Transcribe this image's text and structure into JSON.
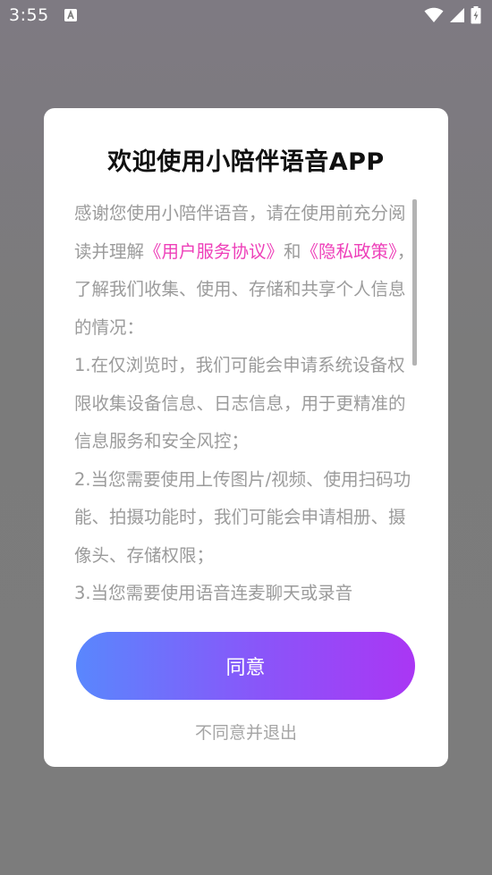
{
  "status_bar": {
    "time": "3:55",
    "icons": [
      "a-icon",
      "wifi-icon",
      "signal-icon",
      "battery-icon"
    ]
  },
  "dialog": {
    "title": "欢迎使用小陪伴语音APP",
    "intro_prefix": "感谢您使用小陪伴语音，请在使用前充分阅读并理解",
    "link_user_agreement": "《用户服务协议》",
    "intro_and": "和",
    "link_privacy_policy": "《隐私政策》",
    "intro_suffix": "，了解我们收集、使用、存储和共享个人信息的情况：",
    "item_1": " 1.在仅浏览时，我们可能会申请系统设备权限收集设备信息、日志信息，用于更精准的信息服务和安全风控；",
    "item_2": " 2.当您需要使用上传图片/视频、使用扫码功能、拍摄功能时，我们可能会申请相册、摄像头、存储权限；",
    "item_3": " 3.当您需要使用语音连麦聊天或录音",
    "agree_label": "同意",
    "disagree_label": "不同意并退出"
  },
  "colors": {
    "link": "#ee3fb9",
    "button_gradient_start": "#5987fd",
    "button_gradient_end": "#aa36f4"
  }
}
